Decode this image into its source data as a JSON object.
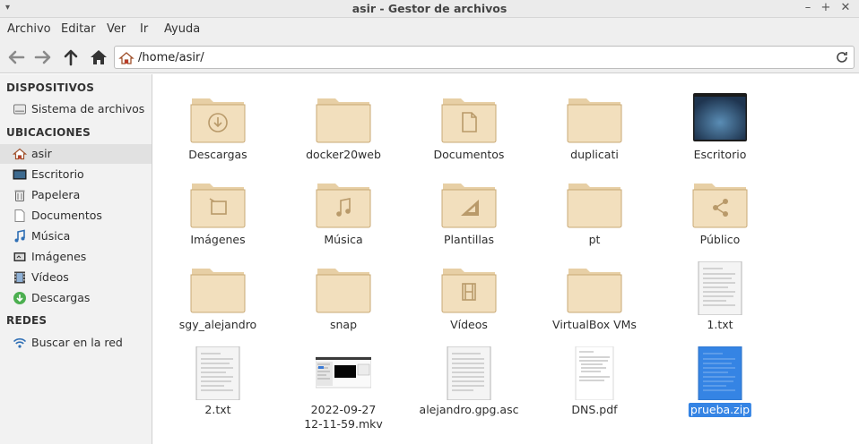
{
  "window": {
    "title": "asir - Gestor de archivos"
  },
  "menubar": {
    "items": [
      "Archivo",
      "Editar",
      "Ver",
      "Ir",
      "Ayuda"
    ]
  },
  "toolbar": {
    "path": "/home/asir/"
  },
  "sidebar": {
    "sections": [
      {
        "heading": "DISPOSITIVOS",
        "items": [
          {
            "label": "Sistema de archivos",
            "icon": "drive-icon"
          }
        ]
      },
      {
        "heading": "UBICACIONES",
        "items": [
          {
            "label": "asir",
            "icon": "home-icon",
            "active": true
          },
          {
            "label": "Escritorio",
            "icon": "desktop-icon"
          },
          {
            "label": "Papelera",
            "icon": "trash-icon"
          },
          {
            "label": "Documentos",
            "icon": "document-icon"
          },
          {
            "label": "Música",
            "icon": "music-icon"
          },
          {
            "label": "Imágenes",
            "icon": "image-icon"
          },
          {
            "label": "Vídeos",
            "icon": "video-icon"
          },
          {
            "label": "Descargas",
            "icon": "download-icon"
          }
        ]
      },
      {
        "heading": "REDES",
        "items": [
          {
            "label": "Buscar en la red",
            "icon": "network-icon"
          }
        ]
      }
    ]
  },
  "files": [
    {
      "name": "Descargas",
      "kind": "folder",
      "emblem": "download"
    },
    {
      "name": "docker20web",
      "kind": "folder",
      "emblem": "none"
    },
    {
      "name": "Documentos",
      "kind": "folder",
      "emblem": "document"
    },
    {
      "name": "duplicati",
      "kind": "folder",
      "emblem": "none"
    },
    {
      "name": "Escritorio",
      "kind": "desktop",
      "emblem": "none"
    },
    {
      "name": "Imágenes",
      "kind": "folder",
      "emblem": "image"
    },
    {
      "name": "Música",
      "kind": "folder",
      "emblem": "music"
    },
    {
      "name": "Plantillas",
      "kind": "folder",
      "emblem": "template"
    },
    {
      "name": "pt",
      "kind": "folder",
      "emblem": "none"
    },
    {
      "name": "Público",
      "kind": "folder",
      "emblem": "share"
    },
    {
      "name": "sgy_alejandro",
      "kind": "folder",
      "emblem": "none"
    },
    {
      "name": "snap",
      "kind": "folder",
      "emblem": "none"
    },
    {
      "name": "Vídeos",
      "kind": "folder",
      "emblem": "video"
    },
    {
      "name": "VirtualBox VMs",
      "kind": "folder",
      "emblem": "none"
    },
    {
      "name": "1.txt",
      "kind": "text",
      "emblem": "none"
    },
    {
      "name": "2.txt",
      "kind": "text",
      "emblem": "none"
    },
    {
      "name": "2022-09-27\n12-11-59.mkv",
      "kind": "video-file",
      "emblem": "none"
    },
    {
      "name": "alejandro.gpg.asc",
      "kind": "text",
      "emblem": "none"
    },
    {
      "name": "DNS.pdf",
      "kind": "pdf",
      "emblem": "none"
    },
    {
      "name": "prueba.zip",
      "kind": "zip",
      "emblem": "none",
      "selected": true
    }
  ],
  "colors": {
    "selection": "#3584e4",
    "folder": "#f2dfbd",
    "sidebar_bg": "#f2f2f2"
  }
}
